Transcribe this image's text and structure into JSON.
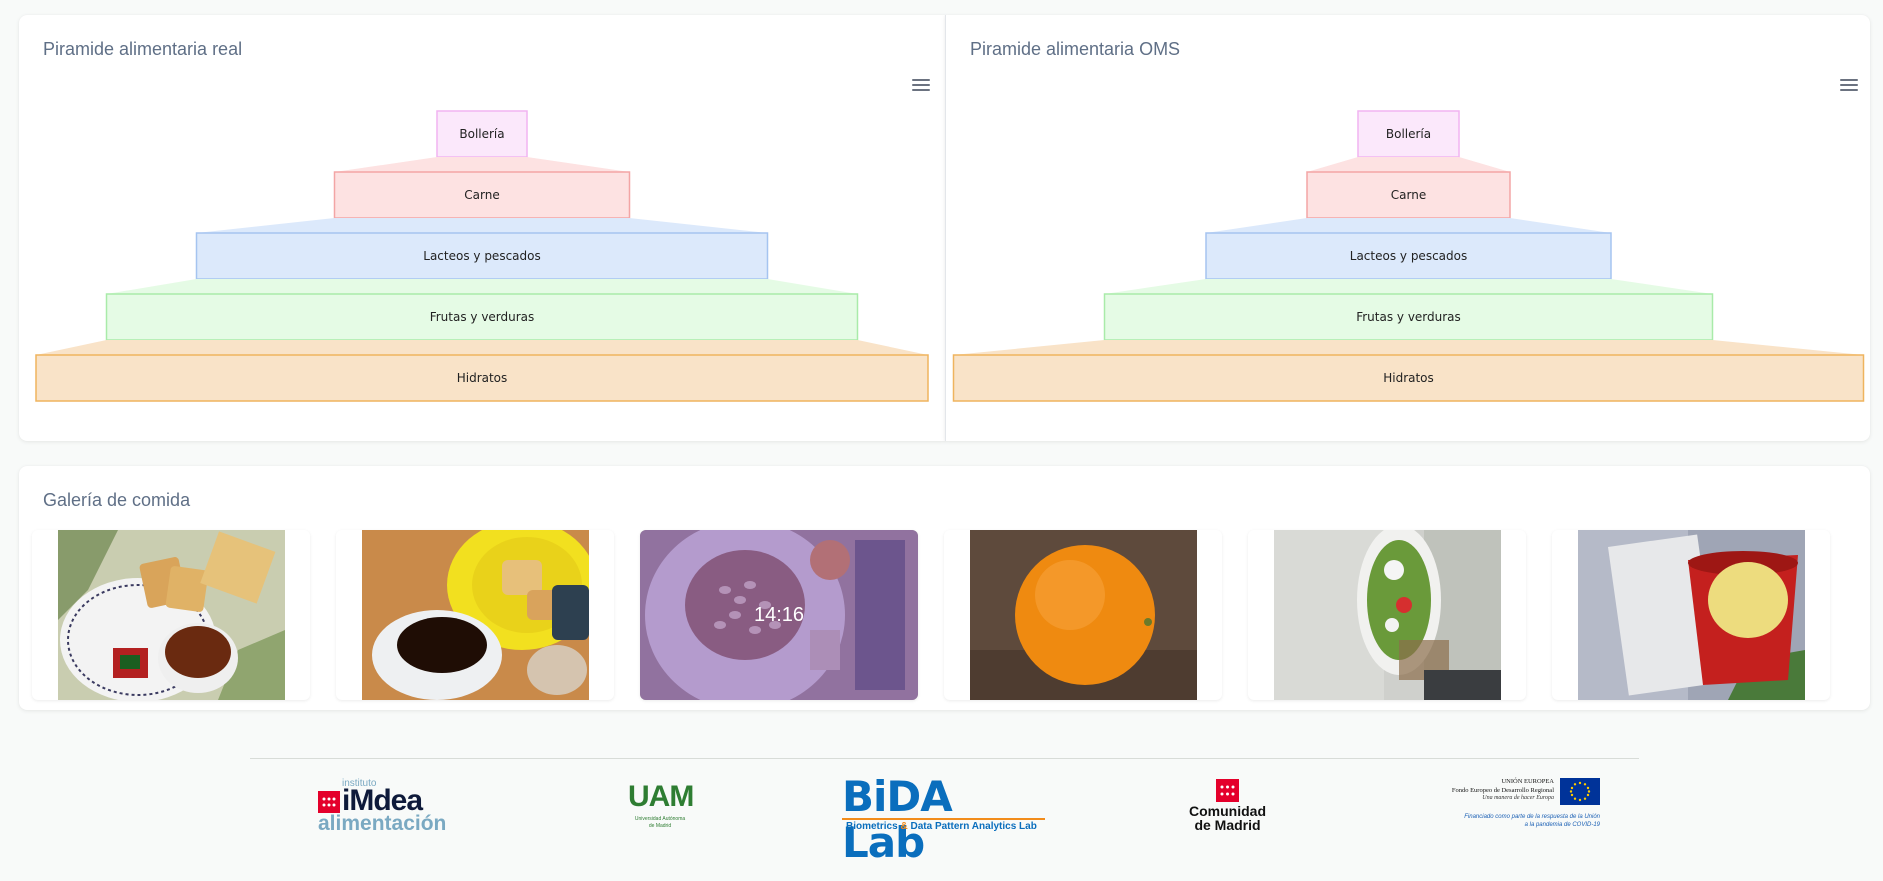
{
  "pyramid_real": {
    "title": "Piramide alimentaria real",
    "menu_icon": "hamburger-menu-icon",
    "levels": [
      {
        "label": "Bollería",
        "fill": "#fbe8fb",
        "stroke": "#f1b4f1"
      },
      {
        "label": "Carne",
        "fill": "#fde2e2",
        "stroke": "#f3a5a5"
      },
      {
        "label": "Lacteos y pescados",
        "fill": "#dce9fb",
        "stroke": "#a5c4f0"
      },
      {
        "label": "Frutas y verduras",
        "fill": "#e5fbe5",
        "stroke": "#a9eba9"
      },
      {
        "label": "Hidratos",
        "fill": "#f9e3c8",
        "stroke": "#efb45e"
      }
    ]
  },
  "pyramid_oms": {
    "title": "Piramide alimentaria OMS",
    "menu_icon": "hamburger-menu-icon",
    "levels": [
      {
        "label": "Bollería",
        "fill": "#fbe8fb",
        "stroke": "#f1b4f1"
      },
      {
        "label": "Carne",
        "fill": "#fde2e2",
        "stroke": "#f3a5a5"
      },
      {
        "label": "Lacteos y pescados",
        "fill": "#dce9fb",
        "stroke": "#a5c4f0"
      },
      {
        "label": "Frutas y verduras",
        "fill": "#e5fbe5",
        "stroke": "#a9eba9"
      },
      {
        "label": "Hidratos",
        "fill": "#f9e3c8",
        "stroke": "#efb45e"
      }
    ]
  },
  "gallery": {
    "title": "Galería de comida",
    "items": [
      {
        "name": "breakfast-tea-biscuits-photo",
        "overlay": ""
      },
      {
        "name": "coffee-toast-photo",
        "overlay": ""
      },
      {
        "name": "bean-stew-photo",
        "overlay": "14:16"
      },
      {
        "name": "orange-photo",
        "overlay": ""
      },
      {
        "name": "salad-plate-photo",
        "overlay": ""
      },
      {
        "name": "red-mug-drink-photo",
        "overlay": ""
      }
    ]
  },
  "footer": {
    "imdea": {
      "top": "instituto",
      "main_a": "i",
      "main_b": "M",
      "main_c": "dea",
      "bottom": "alimentación"
    },
    "uam": {
      "main": "UAM",
      "sub1": "Universidad Autónoma",
      "sub2": "de Madrid"
    },
    "bida": {
      "main_a": "BiDA",
      "main_b": "Lab",
      "sub_a": "Biometrics",
      "sub_amp": "&",
      "sub_b": "Data Pattern Analytics Lab"
    },
    "comunidad": {
      "line1": "Comunidad",
      "line2": "de Madrid"
    },
    "ue": {
      "line1": "UNIÓN EUROPEA",
      "line2": "Fondo Europeo de Desarrollo Regional",
      "line3": "Una manera de hacer Europa",
      "line4": "Financiado como parte de la respuesta de la Unión",
      "line5": "a la pandemia de COVID-19"
    }
  },
  "colors": {
    "title": "#5f6f86",
    "bida_blue": "#0a6ebd",
    "bida_orange": "#f28c1b",
    "uam_green": "#2e7d32",
    "madrid_red": "#e4002b",
    "eu_blue": "#003399",
    "eu_gold": "#ffcc00"
  }
}
